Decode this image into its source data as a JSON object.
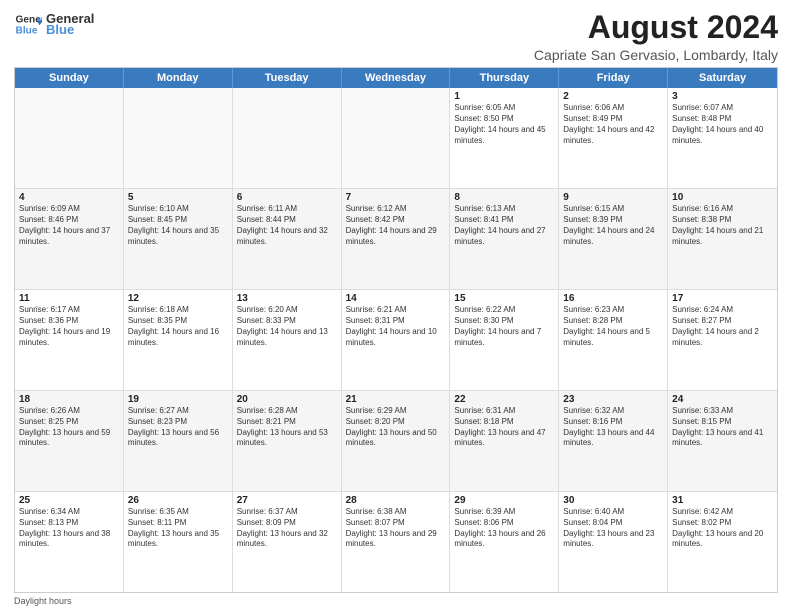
{
  "header": {
    "logo_line1": "General",
    "logo_line2": "Blue",
    "main_title": "August 2024",
    "sub_title": "Capriate San Gervasio, Lombardy, Italy"
  },
  "days_of_week": [
    "Sunday",
    "Monday",
    "Tuesday",
    "Wednesday",
    "Thursday",
    "Friday",
    "Saturday"
  ],
  "weeks": [
    [
      {
        "day": "",
        "info": ""
      },
      {
        "day": "",
        "info": ""
      },
      {
        "day": "",
        "info": ""
      },
      {
        "day": "",
        "info": ""
      },
      {
        "day": "1",
        "info": "Sunrise: 6:05 AM\nSunset: 8:50 PM\nDaylight: 14 hours and 45 minutes."
      },
      {
        "day": "2",
        "info": "Sunrise: 6:06 AM\nSunset: 8:49 PM\nDaylight: 14 hours and 42 minutes."
      },
      {
        "day": "3",
        "info": "Sunrise: 6:07 AM\nSunset: 8:48 PM\nDaylight: 14 hours and 40 minutes."
      }
    ],
    [
      {
        "day": "4",
        "info": "Sunrise: 6:09 AM\nSunset: 8:46 PM\nDaylight: 14 hours and 37 minutes."
      },
      {
        "day": "5",
        "info": "Sunrise: 6:10 AM\nSunset: 8:45 PM\nDaylight: 14 hours and 35 minutes."
      },
      {
        "day": "6",
        "info": "Sunrise: 6:11 AM\nSunset: 8:44 PM\nDaylight: 14 hours and 32 minutes."
      },
      {
        "day": "7",
        "info": "Sunrise: 6:12 AM\nSunset: 8:42 PM\nDaylight: 14 hours and 29 minutes."
      },
      {
        "day": "8",
        "info": "Sunrise: 6:13 AM\nSunset: 8:41 PM\nDaylight: 14 hours and 27 minutes."
      },
      {
        "day": "9",
        "info": "Sunrise: 6:15 AM\nSunset: 8:39 PM\nDaylight: 14 hours and 24 minutes."
      },
      {
        "day": "10",
        "info": "Sunrise: 6:16 AM\nSunset: 8:38 PM\nDaylight: 14 hours and 21 minutes."
      }
    ],
    [
      {
        "day": "11",
        "info": "Sunrise: 6:17 AM\nSunset: 8:36 PM\nDaylight: 14 hours and 19 minutes."
      },
      {
        "day": "12",
        "info": "Sunrise: 6:18 AM\nSunset: 8:35 PM\nDaylight: 14 hours and 16 minutes."
      },
      {
        "day": "13",
        "info": "Sunrise: 6:20 AM\nSunset: 8:33 PM\nDaylight: 14 hours and 13 minutes."
      },
      {
        "day": "14",
        "info": "Sunrise: 6:21 AM\nSunset: 8:31 PM\nDaylight: 14 hours and 10 minutes."
      },
      {
        "day": "15",
        "info": "Sunrise: 6:22 AM\nSunset: 8:30 PM\nDaylight: 14 hours and 7 minutes."
      },
      {
        "day": "16",
        "info": "Sunrise: 6:23 AM\nSunset: 8:28 PM\nDaylight: 14 hours and 5 minutes."
      },
      {
        "day": "17",
        "info": "Sunrise: 6:24 AM\nSunset: 8:27 PM\nDaylight: 14 hours and 2 minutes."
      }
    ],
    [
      {
        "day": "18",
        "info": "Sunrise: 6:26 AM\nSunset: 8:25 PM\nDaylight: 13 hours and 59 minutes."
      },
      {
        "day": "19",
        "info": "Sunrise: 6:27 AM\nSunset: 8:23 PM\nDaylight: 13 hours and 56 minutes."
      },
      {
        "day": "20",
        "info": "Sunrise: 6:28 AM\nSunset: 8:21 PM\nDaylight: 13 hours and 53 minutes."
      },
      {
        "day": "21",
        "info": "Sunrise: 6:29 AM\nSunset: 8:20 PM\nDaylight: 13 hours and 50 minutes."
      },
      {
        "day": "22",
        "info": "Sunrise: 6:31 AM\nSunset: 8:18 PM\nDaylight: 13 hours and 47 minutes."
      },
      {
        "day": "23",
        "info": "Sunrise: 6:32 AM\nSunset: 8:16 PM\nDaylight: 13 hours and 44 minutes."
      },
      {
        "day": "24",
        "info": "Sunrise: 6:33 AM\nSunset: 8:15 PM\nDaylight: 13 hours and 41 minutes."
      }
    ],
    [
      {
        "day": "25",
        "info": "Sunrise: 6:34 AM\nSunset: 8:13 PM\nDaylight: 13 hours and 38 minutes."
      },
      {
        "day": "26",
        "info": "Sunrise: 6:35 AM\nSunset: 8:11 PM\nDaylight: 13 hours and 35 minutes."
      },
      {
        "day": "27",
        "info": "Sunrise: 6:37 AM\nSunset: 8:09 PM\nDaylight: 13 hours and 32 minutes."
      },
      {
        "day": "28",
        "info": "Sunrise: 6:38 AM\nSunset: 8:07 PM\nDaylight: 13 hours and 29 minutes."
      },
      {
        "day": "29",
        "info": "Sunrise: 6:39 AM\nSunset: 8:06 PM\nDaylight: 13 hours and 26 minutes."
      },
      {
        "day": "30",
        "info": "Sunrise: 6:40 AM\nSunset: 8:04 PM\nDaylight: 13 hours and 23 minutes."
      },
      {
        "day": "31",
        "info": "Sunrise: 6:42 AM\nSunset: 8:02 PM\nDaylight: 13 hours and 20 minutes."
      }
    ]
  ],
  "footer": {
    "note": "Daylight hours"
  },
  "colors": {
    "header_bg": "#3a7abf",
    "header_text": "#ffffff",
    "border": "#cccccc",
    "alt_row": "#f5f5f5"
  }
}
